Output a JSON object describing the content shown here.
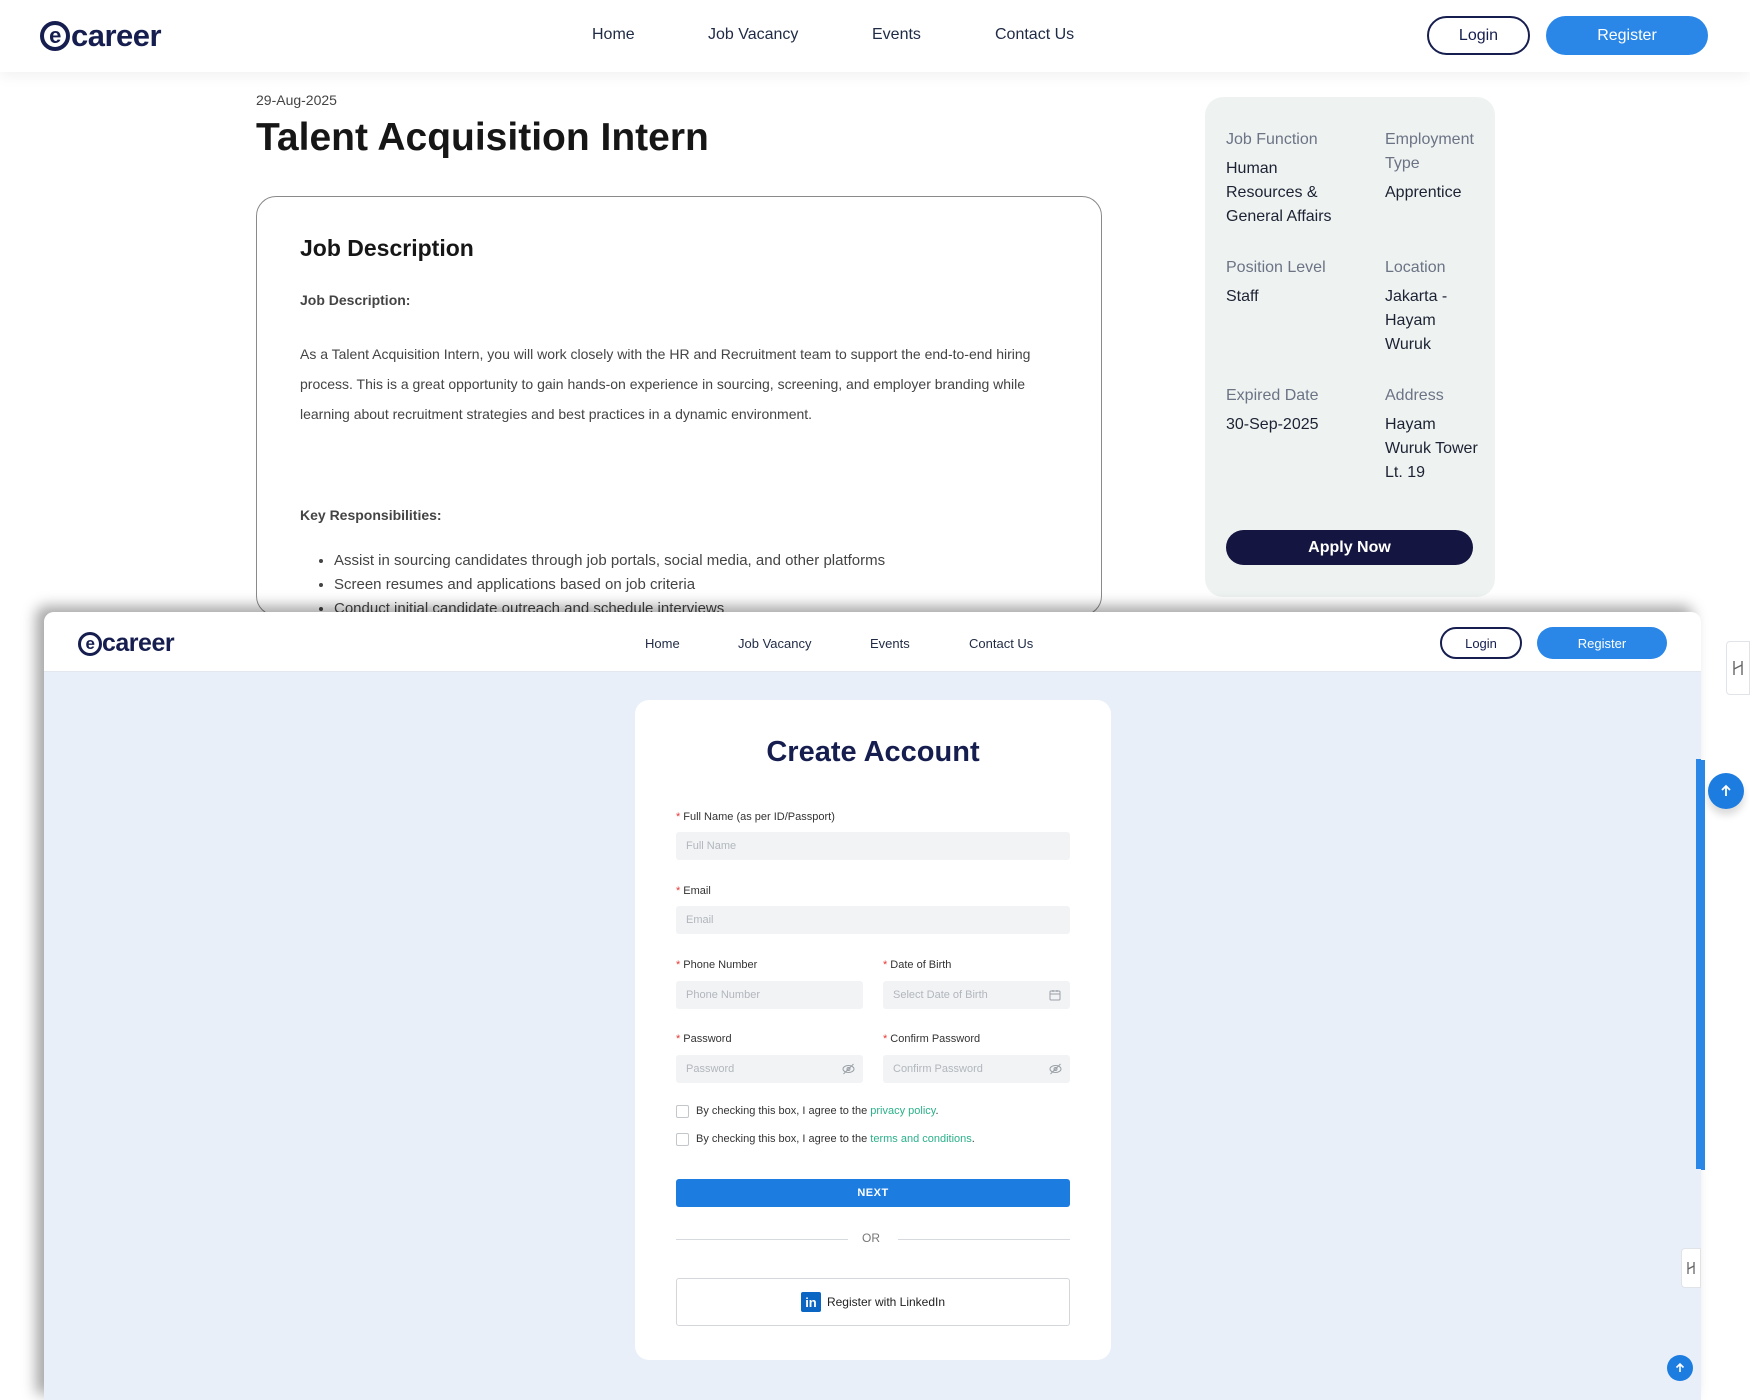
{
  "brand": {
    "logo_text": "ecareer",
    "logo_mark": "e",
    "logo_rest": "career",
    "primary": "#2a87e8",
    "navy": "#161e4f"
  },
  "nav": {
    "items": [
      "Home",
      "Job Vacancy",
      "Events",
      "Contact Us"
    ],
    "login": "Login",
    "register": "Register"
  },
  "job": {
    "posted_date": "29-Aug-2025",
    "title": "Talent Acquisition Intern",
    "card_heading": "Job Description",
    "desc_label": "Job Description:",
    "description": "As a Talent Acquisition Intern, you will work closely with the HR and Recruitment team to support the end-to-end hiring process. This is a great opportunity to gain hands-on experience in sourcing, screening, and employer branding while learning about recruitment strategies and best practices in a dynamic environment.",
    "resp_label": "Key Responsibilities:",
    "responsibilities": [
      "Assist in sourcing candidates through job portals, social media, and other platforms",
      "Screen resumes and applications based on job criteria",
      "Conduct initial candidate outreach and schedule interviews"
    ]
  },
  "summary": {
    "job_function_label": "Job Function",
    "job_function": "Human Resources & General Affairs",
    "employment_type_label": "Employment Type",
    "employment_type": "Apprentice",
    "position_level_label": "Position Level",
    "position_level": "Staff",
    "location_label": "Location",
    "location": "Jakarta - Hayam Wuruk",
    "expired_label": "Expired Date",
    "expired": "30-Sep-2025",
    "address_label": "Address",
    "address": "Hayam Wuruk Tower Lt. 19",
    "apply": "Apply Now"
  },
  "register_form": {
    "title": "Create Account",
    "full_name_label": "Full Name (as per ID/Passport)",
    "full_name_placeholder": "Full Name",
    "email_label": "Email",
    "email_placeholder": "Email",
    "phone_label": "Phone Number",
    "phone_placeholder": "Phone Number",
    "dob_label": "Date of Birth",
    "dob_placeholder": "Select Date of Birth",
    "password_label": "Password",
    "password_placeholder": "Password",
    "confirm_label": "Confirm Password",
    "confirm_placeholder": "Confirm Password",
    "agree_prefix": "By checking this box, I agree to the",
    "privacy_link": "privacy policy",
    "terms_link": "terms and conditions",
    "next": "NEXT",
    "or": "OR",
    "linkedin": "Register with LinkedIn",
    "linkedin_icon": "in",
    "required_mark": "*"
  }
}
